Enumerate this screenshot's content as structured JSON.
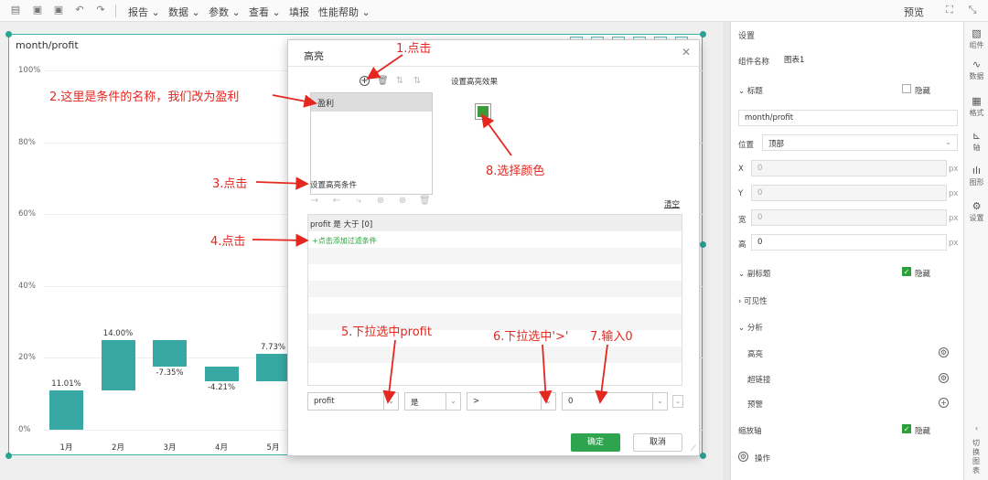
{
  "toolbar": {
    "menus": [
      "报告",
      "数据",
      "参数",
      "查看",
      "填报",
      "性能帮助"
    ],
    "preview": "预览"
  },
  "widget": {
    "title": "month/profit",
    "y_ticks": [
      "100%",
      "80%",
      "60%",
      "40%",
      "20%",
      "0%"
    ]
  },
  "chart_data": {
    "type": "bar",
    "categories": [
      "1月",
      "2月",
      "3月",
      "4月",
      "5月"
    ],
    "values": [
      11.01,
      14.0,
      -7.35,
      -4.21,
      7.73
    ],
    "labels": [
      "11.01%",
      "14.00%",
      "-7.35%",
      "-4.21%",
      "7.73%"
    ],
    "ylim": [
      0,
      100
    ],
    "y_ticks": [
      "100%",
      "80%",
      "60%",
      "40%",
      "20%",
      "0%"
    ],
    "waterfall": true,
    "color": "#37a8a3"
  },
  "dialog": {
    "title": "高亮",
    "list_item": "盈利",
    "effect_label": "设置高亮效果",
    "effect_color": "#3f9a3c",
    "condition_label": "设置高亮条件",
    "clear": "清空",
    "condition_text": "profit 是 大于 [0]",
    "add_filter": "+点击添加过滤条件",
    "field_select": "profit",
    "is_select": "是",
    "op_select": ">",
    "value_input": "0",
    "ok": "确定",
    "cancel": "取消"
  },
  "right_panel": {
    "header": "设置",
    "component_name_label": "组件名称",
    "component_name": "图表1",
    "title_section": "标题",
    "hide": "隐藏",
    "title_value": "month/profit",
    "position_label": "位置",
    "position_value": "顶部",
    "x_label": "X",
    "x_value": "0",
    "y_label": "Y",
    "y_value": "0",
    "w_label": "宽",
    "w_value": "0",
    "h_label": "高",
    "h_value": "0",
    "unit": "px",
    "subtitle": "副标题",
    "visibility": "可见性",
    "analysis": "分析",
    "highlight": "高亮",
    "hyperlink": "超链接",
    "warning": "预警",
    "zoom_axis": "缩放轴",
    "operation": "操作"
  },
  "right_sidebar": {
    "items": [
      "组件",
      "数据",
      "格式",
      "轴",
      "图形",
      "设置"
    ],
    "switch": "切换图表"
  },
  "annotations": {
    "a1": "1.点击",
    "a2": "2.这里是条件的名称，我们改为盈利",
    "a3": "3.点击",
    "a4": "4.点击",
    "a5": "5.下拉选中profit",
    "a6": "6.下拉选中'>'",
    "a7": "7.输入0",
    "a8": "8.选择颜色"
  }
}
